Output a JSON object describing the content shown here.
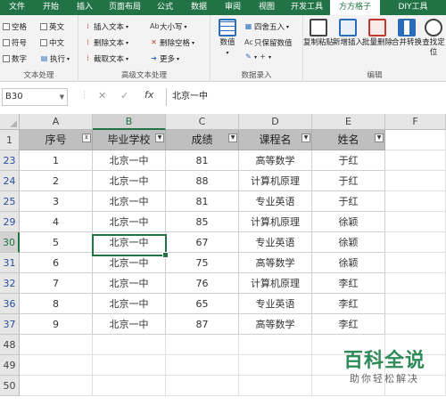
{
  "menubar": {
    "tabs": [
      "文件",
      "开始",
      "插入",
      "页面布局",
      "公式",
      "数据",
      "审阅",
      "视图",
      "开发工具",
      "方方格子",
      "DIY工具"
    ],
    "active_index": 9
  },
  "ribbon": {
    "text_processing": {
      "label": "文本处理",
      "items": {
        "space": "空格",
        "english": "英文",
        "symbol": "符号",
        "chinese": "中文",
        "digit": "数字",
        "execute": "执行"
      }
    },
    "advanced_text": {
      "label": "高级文本处理",
      "items": {
        "insert_text": "插入文本",
        "delete_text": "删除文本",
        "cut_text": "截取文本",
        "case": "大小写",
        "delete_space": "删除空格",
        "more": "更多"
      }
    },
    "data_entry": {
      "label": "数据录入",
      "items": {
        "number": "数值",
        "round": "四舍五入",
        "keep_value": "只保留数值"
      }
    },
    "edit": {
      "label": "编辑",
      "items": {
        "copy_paste": "复制粘贴",
        "new_insert": "新增插入",
        "batch_delete": "批量删除",
        "merge_convert": "合并转换",
        "find_locate": "查找定位"
      }
    }
  },
  "formula_bar": {
    "name_box": "B30",
    "cancel": "✕",
    "confirm": "✓",
    "fx": "fx",
    "content": "北京一中"
  },
  "sheet": {
    "columns": [
      "A",
      "B",
      "C",
      "D",
      "E",
      "F"
    ],
    "selected_column": "B",
    "header_row_number": "1",
    "headers": [
      "序号",
      "毕业学校",
      "成绩",
      "课程名",
      "姓名"
    ],
    "rows": [
      {
        "num": "23",
        "cells": [
          "1",
          "北京一中",
          "81",
          "高等数学",
          "于红"
        ]
      },
      {
        "num": "24",
        "cells": [
          "2",
          "北京一中",
          "88",
          "计算机原理",
          "于红"
        ]
      },
      {
        "num": "25",
        "cells": [
          "3",
          "北京一中",
          "81",
          "专业英语",
          "于红"
        ]
      },
      {
        "num": "29",
        "cells": [
          "4",
          "北京一中",
          "85",
          "计算机原理",
          "徐颖"
        ]
      },
      {
        "num": "30",
        "cells": [
          "5",
          "北京一中",
          "67",
          "专业英语",
          "徐颖"
        ]
      },
      {
        "num": "31",
        "cells": [
          "6",
          "北京一中",
          "75",
          "高等数学",
          "徐颖"
        ]
      },
      {
        "num": "32",
        "cells": [
          "7",
          "北京一中",
          "76",
          "计算机原理",
          "李红"
        ]
      },
      {
        "num": "36",
        "cells": [
          "8",
          "北京一中",
          "65",
          "专业英语",
          "李红"
        ]
      },
      {
        "num": "37",
        "cells": [
          "9",
          "北京一中",
          "87",
          "高等数学",
          "李红"
        ]
      }
    ],
    "empty_rows": [
      "48",
      "49",
      "50"
    ],
    "selected_row": "30"
  },
  "watermark": {
    "title": "百科全说",
    "subtitle": "助你轻松解决"
  }
}
